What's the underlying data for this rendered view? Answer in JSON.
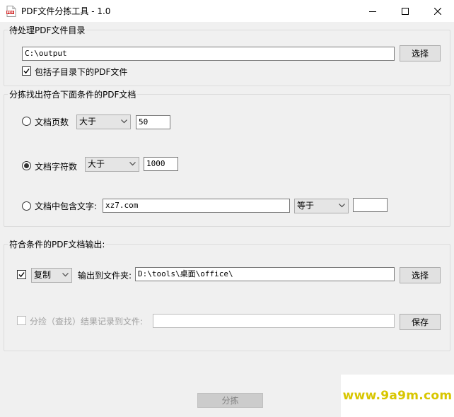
{
  "window": {
    "title": "PDF文件分拣工具 - 1.0",
    "icon": "pdf-file-icon",
    "icon_text": "PDF",
    "controls": [
      "minimize-icon",
      "maximize-icon",
      "close-icon"
    ]
  },
  "source_group": {
    "label": "待处理PDF文件目录",
    "path_value": "C:\\output",
    "browse_label": "选择",
    "include_subdirs_label": "包括子目录下的PDF文件",
    "include_subdirs_checked": true
  },
  "criteria_group": {
    "label": "分拣找出符合下面条件的PDF文档",
    "page_count": {
      "label": "文档页数",
      "selected": false,
      "operator": "大于",
      "value": "50"
    },
    "char_count": {
      "label": "文档字符数",
      "selected": true,
      "operator": "大于",
      "value": "1000"
    },
    "contains_text": {
      "label": "文档中包含文字:",
      "selected": false,
      "text_value": "xz7.com",
      "operator": "等于",
      "value": ""
    }
  },
  "output_group": {
    "label": "符合条件的PDF文档输出:",
    "enabled_checked": true,
    "action": "复制",
    "output_folder_label": "输出到文件夹:",
    "output_folder_value": "D:\\tools\\桌面\\office\\",
    "browse_label": "选择",
    "log_label": "分捡（查找）结果记录到文件:",
    "log_checked": false,
    "log_value": "",
    "save_label": "保存"
  },
  "actions": {
    "sort_label": "分拣"
  },
  "watermark": {
    "text": "www.9a9m.com"
  },
  "colors": {
    "window_bg": "#f0f0f0",
    "watermark": "#d8c600"
  }
}
